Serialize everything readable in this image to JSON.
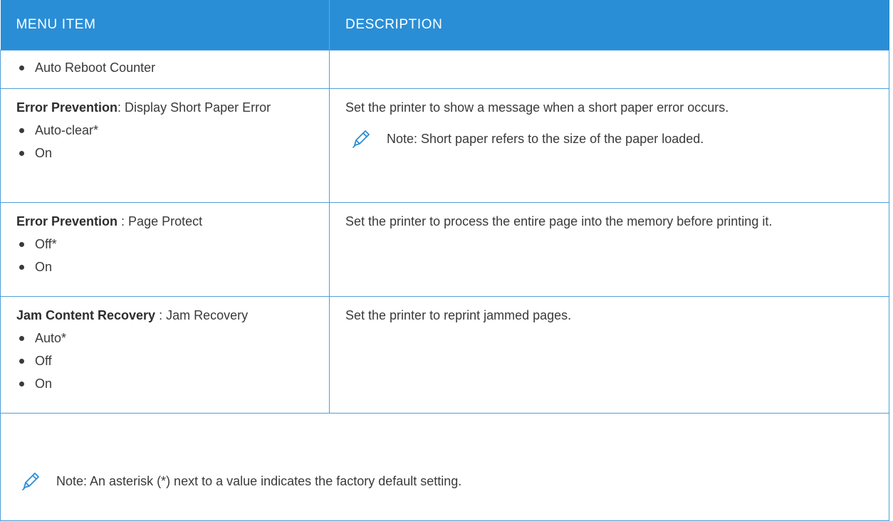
{
  "table": {
    "headers": {
      "item": "MENU ITEM",
      "description": "DESCRIPTION"
    },
    "rows": [
      {
        "title_bold": "",
        "title_rest": "",
        "options": [
          "Auto Reboot Counter"
        ],
        "description": "",
        "note": ""
      },
      {
        "title_bold": "Error Prevention",
        "title_rest": ": Display Short Paper Error",
        "options": [
          "Auto-clear*",
          "On"
        ],
        "description": "Set the printer to show a message when a short paper error occurs.",
        "note": "Note: Short paper refers to the size of the paper loaded."
      },
      {
        "title_bold": "Error Prevention",
        "title_rest": " : Page Protect",
        "options": [
          "Off*",
          "On"
        ],
        "description": "Set the printer to process the entire page into the memory before printing it.",
        "note": ""
      },
      {
        "title_bold": "Jam Content Recovery",
        "title_rest": " : Jam Recovery",
        "options": [
          "Auto*",
          "Off",
          "On"
        ],
        "description": "Set the printer to reprint jammed pages.",
        "note": ""
      }
    ],
    "footer_note": "Note: An asterisk (*) next to a value indicates the factory default setting."
  },
  "icons": {
    "note_icon": "pencil-icon"
  },
  "colors": {
    "header_background": "#2a8ed6",
    "border": "#4f9fd9",
    "text": "#3a3a3a"
  }
}
